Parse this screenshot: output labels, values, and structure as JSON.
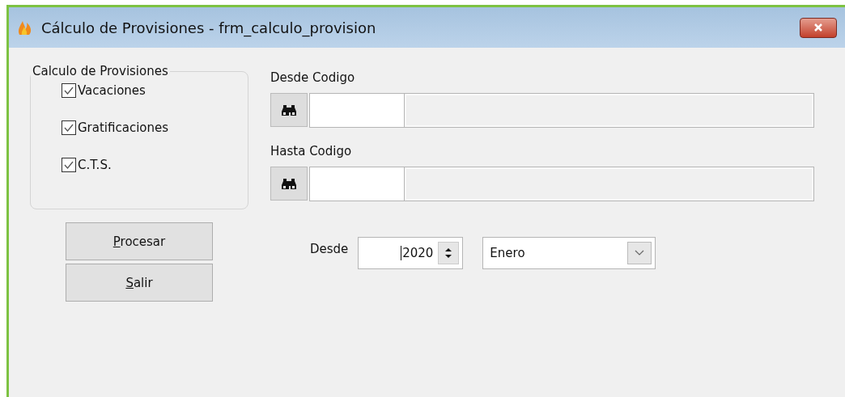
{
  "window": {
    "title": "Cálculo de Provisiones - frm_calculo_provision"
  },
  "group": {
    "title": "Calculo de Provisiones",
    "options": [
      {
        "label": "Vacaciones",
        "checked": true
      },
      {
        "label": "Gratificaciones",
        "checked": true
      },
      {
        "label": "C.T.S.",
        "checked": true
      }
    ]
  },
  "buttons": [
    {
      "mnemonic": "P",
      "rest": "rocesar"
    },
    {
      "mnemonic": "S",
      "rest": "alir"
    }
  ],
  "lookups": [
    {
      "label": "Desde Codigo"
    },
    {
      "label": "Hasta Codigo"
    }
  ],
  "period": {
    "label": "Desde",
    "year": "2020",
    "month": "Enero"
  }
}
